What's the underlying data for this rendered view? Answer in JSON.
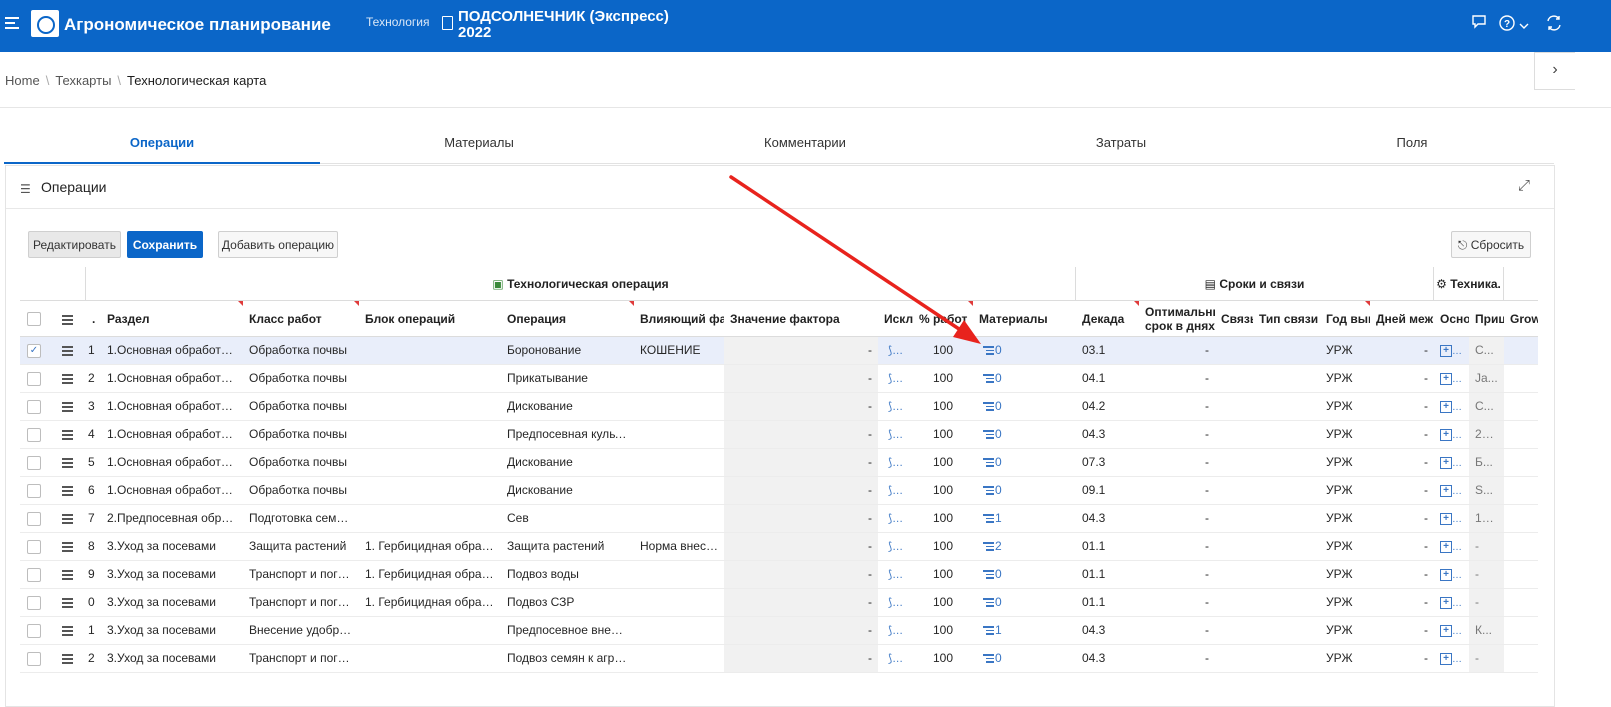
{
  "app": {
    "title": "Агрономическое планирование",
    "tech_label": "Технология",
    "crop_line1": "ПОДСОЛНЕЧНИК (Экспресс)",
    "crop_line2": "2022",
    "accent": "#0b66c8"
  },
  "header_icons": [
    "menu-icon",
    "chat-icon",
    "help-icon",
    "chevron-down-icon",
    "refresh-icon"
  ],
  "breadcrumb": {
    "home": "Home",
    "parent": "Техкарты",
    "current": "Технологическая карта"
  },
  "tabs": [
    {
      "label": "Операции",
      "active": true
    },
    {
      "label": "Материалы"
    },
    {
      "label": "Комментарии"
    },
    {
      "label": "Затраты"
    },
    {
      "label": "Поля"
    }
  ],
  "region": {
    "title": "Операции"
  },
  "toolbar": {
    "edit": "Редактировать",
    "save": "Сохранить",
    "add": "Добавить операцию",
    "reset": "Сбросить"
  },
  "groups": {
    "tech_op": "Технологическая операция",
    "terms": "Сроки и связи",
    "tech": "Техника."
  },
  "columns": {
    "razdel": "Раздел",
    "klass": "Класс работ",
    "blok": "Блок операций",
    "operaciya": "Операция",
    "factor": "Влияющий факт",
    "factor_val": "Значение фактора",
    "iskl": "Искл",
    "pct": "% работ",
    "materials": "Материалы",
    "dekada": "Декада",
    "opt_l1": "Оптимальный",
    "opt_l2": "срок в днях",
    "svyaz": "Связь",
    "tip": "Тип связи",
    "god": "Год вып",
    "dney": "Дней меж",
    "osnov": "Осно",
    "pric": "Прицеп",
    "grow": "Grow"
  },
  "rows": [
    {
      "n": "1",
      "razdel": "1.Основная обработка п...",
      "klass": "Обработка почвы",
      "blok": "",
      "op": "Боронование",
      "factor": "КОШЕНИЕ",
      "fval": "-",
      "pct": "100",
      "mat": "0",
      "dek": "03.1",
      "opt": "-",
      "god": "УРЖ",
      "dney": "-",
      "pric": "С...",
      "sel": true
    },
    {
      "n": "2",
      "razdel": "1.Основная обработка п...",
      "klass": "Обработка почвы",
      "blok": "",
      "op": "Прикатывание",
      "factor": "",
      "fval": "-",
      "pct": "100",
      "mat": "0",
      "dek": "04.1",
      "opt": "-",
      "god": "УРЖ",
      "dney": "-",
      "pric": "Ja..."
    },
    {
      "n": "3",
      "razdel": "1.Основная обработка п...",
      "klass": "Обработка почвы",
      "blok": "",
      "op": "Дискование",
      "factor": "",
      "fval": "-",
      "pct": "100",
      "mat": "0",
      "dek": "04.2",
      "opt": "-",
      "god": "УРЖ",
      "dney": "-",
      "pric": "С..."
    },
    {
      "n": "4",
      "razdel": "1.Основная обработка п...",
      "klass": "Обработка почвы",
      "blok": "",
      "op": "Предпосевная культи...",
      "factor": "",
      "fval": "-",
      "pct": "100",
      "mat": "0",
      "dek": "04.3",
      "opt": "-",
      "god": "УРЖ",
      "dney": "-",
      "pric": "22..."
    },
    {
      "n": "5",
      "razdel": "1.Основная обработка п...",
      "klass": "Обработка почвы",
      "blok": "",
      "op": "Дискование",
      "factor": "",
      "fval": "-",
      "pct": "100",
      "mat": "0",
      "dek": "07.3",
      "opt": "-",
      "god": "УРЖ",
      "dney": "-",
      "pric": "Б..."
    },
    {
      "n": "6",
      "razdel": "1.Основная обработка п...",
      "klass": "Обработка почвы",
      "blok": "",
      "op": "Дискование",
      "factor": "",
      "fval": "-",
      "pct": "100",
      "mat": "0",
      "dek": "09.1",
      "opt": "-",
      "god": "УРЖ",
      "dney": "-",
      "pric": "S..."
    },
    {
      "n": "7",
      "razdel": "2.Предпосевная обрабо...",
      "klass": "Подготовка семян ...",
      "blok": "",
      "op": "Сев",
      "factor": "",
      "fval": "-",
      "pct": "100",
      "mat": "1",
      "dek": "04.3",
      "opt": "-",
      "god": "УРЖ",
      "dney": "-",
      "pric": "16..."
    },
    {
      "n": "8",
      "razdel": "3.Уход за посевами",
      "klass": "Защита растений",
      "blok": "1. Гербицидная обработ...",
      "op": "Защита растений",
      "factor": "Норма внесе...",
      "fval": "-",
      "pct": "100",
      "mat": "2",
      "dek": "01.1",
      "opt": "-",
      "god": "УРЖ",
      "dney": "-",
      "pric": "-"
    },
    {
      "n": "9",
      "razdel": "3.Уход за посевами",
      "klass": "Транспорт и погру...",
      "blok": "1. Гербицидная обработ...",
      "op": "Подвоз воды",
      "factor": "",
      "fval": "-",
      "pct": "100",
      "mat": "0",
      "dek": "01.1",
      "opt": "-",
      "god": "УРЖ",
      "dney": "-",
      "pric": "-"
    },
    {
      "n": "0",
      "razdel": "3.Уход за посевами",
      "klass": "Транспорт и погру...",
      "blok": "1. Гербицидная обработ...",
      "op": "Подвоз СЗР",
      "factor": "",
      "fval": "-",
      "pct": "100",
      "mat": "0",
      "dek": "01.1",
      "opt": "-",
      "god": "УРЖ",
      "dney": "-",
      "pric": "-"
    },
    {
      "n": "1",
      "razdel": "3.Уход за посевами",
      "klass": "Внесение удобрен...",
      "blok": "",
      "op": "Предпосевное внесен...",
      "factor": "",
      "fval": "-",
      "pct": "100",
      "mat": "1",
      "dek": "04.3",
      "opt": "-",
      "god": "УРЖ",
      "dney": "-",
      "pric": "К..."
    },
    {
      "n": "2",
      "razdel": "3.Уход за посевами",
      "klass": "Транспорт и погру...",
      "blok": "",
      "op": "Подвоз семян к агрег...",
      "factor": "",
      "fval": "-",
      "pct": "100",
      "mat": "0",
      "dek": "04.3",
      "opt": "-",
      "god": "УРЖ",
      "dney": "-",
      "pric": "-"
    }
  ]
}
